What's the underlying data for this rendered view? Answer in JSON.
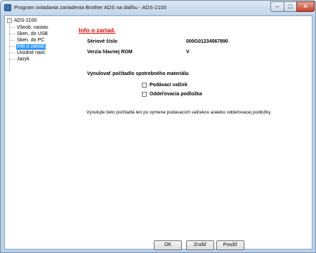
{
  "window": {
    "title": "Program ovladania zariadenia Brother ADS na diaľku - ADS-2100",
    "minimize_glyph": "–",
    "maximize_glyph": "□",
    "close_glyph": "✕"
  },
  "tree": {
    "root_label": "ADS-2100",
    "expander_glyph": "−",
    "items": [
      {
        "label": "Všeob. nastav."
      },
      {
        "label": "Sken. do USB"
      },
      {
        "label": "Sken. do PC"
      },
      {
        "label": "Info o zariad."
      },
      {
        "label": "Úvodné nast."
      },
      {
        "label": "Jazyk"
      }
    ],
    "selected_index": 3
  },
  "main": {
    "title": "Info o zariad.",
    "serial_label": "Sériové číslo",
    "serial_value": "000G01234567890",
    "rom_label": "Verzia hlavnej ROM",
    "rom_value": "V",
    "reset_heading": "Vynulovať počítadlo spotrebného materiálu",
    "checkboxes": [
      {
        "label": "Podávací valček",
        "checked": false
      },
      {
        "label": "Oddeľovacia podložka",
        "checked": false
      }
    ],
    "hint": "Vynulujte tieto počítadlá len po výmene podávacích valčekov a/alebo oddeľovacej podložky"
  },
  "footer": {
    "ok_label": "OK",
    "cancel_label": "Zrušiť",
    "apply_label": "Použiť"
  }
}
